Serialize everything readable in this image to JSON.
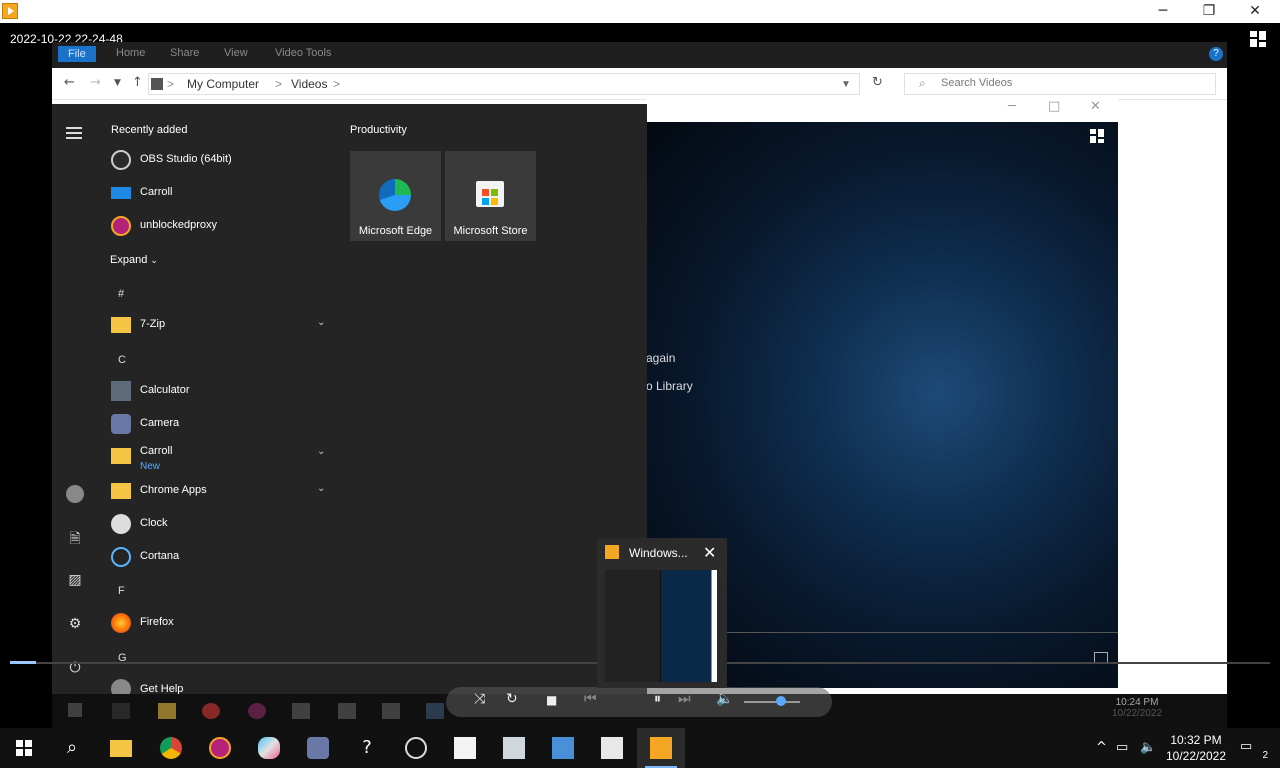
{
  "outer_window": {
    "timestamp": "2022-10-22 22-24-48",
    "minimize": "─",
    "restore": "❐",
    "close": "✕"
  },
  "explorer": {
    "tabs": [
      "File",
      "Home",
      "Share",
      "View",
      "Video Tools"
    ],
    "breadcrumb": [
      "My Computer",
      "Videos"
    ],
    "crumb_sep": ">",
    "search_placeholder": "Search Videos"
  },
  "movies_tv": {
    "text_again": "again",
    "text_library": "o Library"
  },
  "start_menu": {
    "recently_added": "Recently added",
    "recent_items": [
      "OBS Studio (64bit)",
      "Carroll",
      "unblockedproxy"
    ],
    "expand": "Expand",
    "tiles_heading": "Productivity",
    "tiles": [
      "Microsoft Edge",
      "Microsoft Store"
    ],
    "letter_hash": "#",
    "letter_c": "C",
    "letter_f": "F",
    "letter_g": "G",
    "apps": {
      "zip": "7-Zip",
      "calculator": "Calculator",
      "camera": "Camera",
      "carroll": "Carroll",
      "carroll_sub": "New",
      "chrome_apps": "Chrome Apps",
      "clock": "Clock",
      "cortana": "Cortana",
      "firefox": "Firefox",
      "get_help": "Get Help"
    }
  },
  "thumbnail": {
    "title": "Windows..."
  },
  "inner_taskbar": {
    "time": "10:24 PM",
    "date": "10/22/2022"
  },
  "taskbar": {
    "time": "10:32 PM",
    "date": "10/22/2022",
    "notifications": "2"
  }
}
